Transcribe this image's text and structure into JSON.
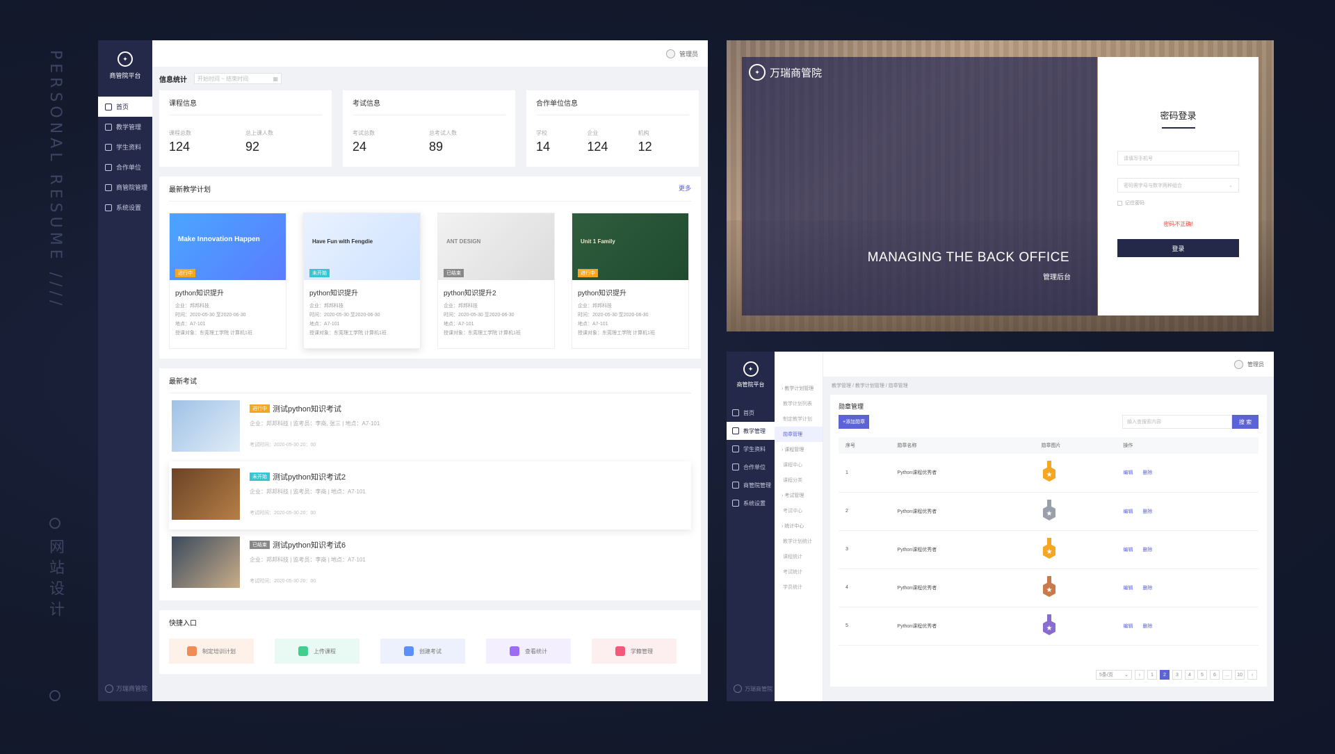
{
  "deco": {
    "vertical_text_1": "PERSONAL RESUME ////",
    "vertical_text_2": "网站设计"
  },
  "dashboard": {
    "platform_name": "商管院平台",
    "user": "管理员",
    "footer_brand": "万瑞商管院",
    "nav": [
      {
        "label": "首页",
        "icon": "home-icon"
      },
      {
        "label": "教学管理",
        "icon": "book-icon"
      },
      {
        "label": "学生资料",
        "icon": "student-icon"
      },
      {
        "label": "合作单位",
        "icon": "building-icon"
      },
      {
        "label": "商管院管理",
        "icon": "manage-icon"
      },
      {
        "label": "系统设置",
        "icon": "gear-icon"
      }
    ],
    "stats_title": "信息统计",
    "date_placeholder": "开始时间 ~ 结束时间",
    "stat_cards": [
      {
        "title": "课程信息",
        "items": [
          {
            "label": "课程总数",
            "value": "124"
          },
          {
            "label": "总上课人数",
            "value": "92"
          }
        ]
      },
      {
        "title": "考试信息",
        "items": [
          {
            "label": "考试总数",
            "value": "24"
          },
          {
            "label": "总考试人数",
            "value": "89"
          }
        ]
      },
      {
        "title": "合作单位信息",
        "items": [
          {
            "label": "学校",
            "value": "14"
          },
          {
            "label": "企业",
            "value": "124"
          },
          {
            "label": "机构",
            "value": "12"
          }
        ]
      }
    ],
    "plans_title": "最新教学计划",
    "more": "更多",
    "plans": [
      {
        "img_text": "Make Innovation Happen",
        "tag": "进行中",
        "tag_color": "#f5a623",
        "title": "python知识提升",
        "company": "企业：邦邦科技",
        "time": "时间：2020-05-30 至2020-06-30",
        "place": "地点：A7-101",
        "teacher": "授课对象：东莞理工学院 计算机1班"
      },
      {
        "img_text": "Have Fun with Fengdie",
        "tag": "未开始",
        "tag_color": "#36c6d3",
        "title": "python知识提升",
        "company": "企业：邦邦科技",
        "time": "时间：2020-05-30 至2020-06-30",
        "place": "地点：A7-101",
        "teacher": "授课对象：东莞理工学院 计算机1班"
      },
      {
        "img_text": "ANT DESIGN",
        "tag": "已结束",
        "tag_color": "#888888",
        "title": "python知识提升2",
        "company": "企业：邦邦科技",
        "time": "时间：2020-05-30 至2020-06-30",
        "place": "地点：A7-101",
        "teacher": "授课对象：东莞理工学院 计算机1班"
      },
      {
        "img_text": "Unit 1 Family",
        "tag": "进行中",
        "tag_color": "#f5a623",
        "title": "python知识提升",
        "company": "企业：邦邦科技",
        "time": "时间：2020-05-30 至2020-06-30",
        "place": "地点：A7-101",
        "teacher": "授课对象：东莞理工学院 计算机1班"
      }
    ],
    "exams_title": "最新考试",
    "exams": [
      {
        "tag": "进行中",
        "tag_color": "#f5a623",
        "title": "测试python知识考试",
        "meta": "企业：邦邦科技  |  监考员：李商, 张三  |  地点：A7-101",
        "time": "考试时间：2020-05-30 20：00"
      },
      {
        "tag": "未开始",
        "tag_color": "#36c6d3",
        "title": "测试python知识考试2",
        "meta": "企业：邦邦科技  |  监考员：李商  |  地点：A7-101",
        "time": "考试时间：2020-05-30 20：00"
      },
      {
        "tag": "已结束",
        "tag_color": "#888888",
        "title": "测试python知识考试6",
        "meta": "企业：邦邦科技  |  监考员：李商  |  地点：A7-101",
        "time": "考试时间：2020-05-30 20：00"
      }
    ],
    "quick_title": "快捷入口",
    "quick": [
      {
        "label": "制定培训计划",
        "bg": "#fdf1ea",
        "color": "#f08d54"
      },
      {
        "label": "上传课程",
        "bg": "#e8faf3",
        "color": "#3fcf8e"
      },
      {
        "label": "创建考试",
        "bg": "#ecf1fd",
        "color": "#5b8ff9"
      },
      {
        "label": "查看统计",
        "bg": "#f3efff",
        "color": "#9b6cf6"
      },
      {
        "label": "学籍管理",
        "bg": "#fdeef0",
        "color": "#f5587a"
      }
    ]
  },
  "login": {
    "brand": "万瑞商管院",
    "slogan": "MANAGING THE BACK OFFICE",
    "sub": "管理后台",
    "title": "密码登录",
    "account_placeholder": "请填写手机号",
    "password_placeholder": "密码需字母与数字两种组合",
    "remember": "记住密码",
    "error": "密码不正确!",
    "button": "登录"
  },
  "medals": {
    "platform_name": "商管院平台",
    "user": "管理员",
    "footer_brand": "万瑞商管院",
    "nav": [
      {
        "label": "首页",
        "icon": "home-icon"
      },
      {
        "label": "教学管理",
        "icon": "book-icon"
      },
      {
        "label": "学生资料",
        "icon": "student-icon"
      },
      {
        "label": "合作单位",
        "icon": "building-icon"
      },
      {
        "label": "商管院管理",
        "icon": "manage-icon"
      },
      {
        "label": "系统设置",
        "icon": "gear-icon"
      }
    ],
    "sub_menu": [
      {
        "label": "教学计划管理",
        "group": true
      },
      {
        "label": "教学计划列表",
        "group": false
      },
      {
        "label": "制定教学计划",
        "group": false
      },
      {
        "label": "勋章管理",
        "group": false,
        "active": true
      },
      {
        "label": "课程管理",
        "group": true
      },
      {
        "label": "课程中心",
        "group": false
      },
      {
        "label": "课程分类",
        "group": false
      },
      {
        "label": "考试管理",
        "group": true
      },
      {
        "label": "考试中心",
        "group": false
      },
      {
        "label": "统计中心",
        "group": true
      },
      {
        "label": "教学计划统计",
        "group": false
      },
      {
        "label": "课程统计",
        "group": false
      },
      {
        "label": "考试统计",
        "group": false
      },
      {
        "label": "学员统计",
        "group": false
      }
    ],
    "breadcrumb": "教学管理 / 教学计划管理 / 勋章管理",
    "card_title": "勋章管理",
    "add_button": "+添加勋章",
    "search_placeholder": "输入查搜索内容",
    "search_button": "搜 索",
    "columns": [
      "序号",
      "勋章名称",
      "勋章图片",
      "操作"
    ],
    "rows": [
      {
        "no": "1",
        "name": "Python课程优秀者",
        "medal": "#f5a623"
      },
      {
        "no": "2",
        "name": "Python课程优秀者",
        "medal": "#9aa0aa"
      },
      {
        "no": "3",
        "name": "Python课程优秀者",
        "medal": "#f5a623"
      },
      {
        "no": "4",
        "name": "Python课程优秀者",
        "medal": "#c87a4d"
      },
      {
        "no": "5",
        "name": "Python课程优秀者",
        "medal": "#8a6cd0"
      }
    ],
    "edit": "编辑",
    "delete": "删除",
    "page_size": "5条/页",
    "pages": [
      "1",
      "2",
      "3",
      "4",
      "5",
      "6",
      "...",
      "10"
    ],
    "active_page": "2"
  }
}
